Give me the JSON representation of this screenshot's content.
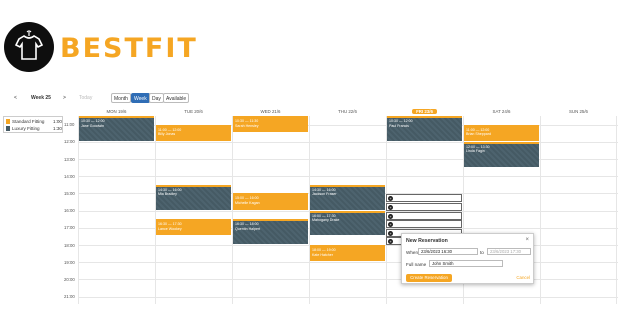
{
  "brand": {
    "name": "BESTFIT",
    "logo_icon": "shirt-icon"
  },
  "toolbar": {
    "prev": "<",
    "week": "Week 25",
    "next": ">",
    "today": "Today",
    "views": [
      "Month",
      "Week",
      "Day",
      "Available"
    ],
    "active_view": "Week"
  },
  "legend": [
    {
      "name": "Standard Fitting",
      "value": "1:00",
      "color": "#f5a623"
    },
    {
      "name": "Luxury Fitting",
      "value": "1:30",
      "color": "#455a64"
    }
  ],
  "days": [
    "MON 19/6",
    "TUE 20/6",
    "WED 21/6",
    "THU 22/6",
    "FRI 23/6",
    "SAT 24/6",
    "SUN 25/6"
  ],
  "today_index": 4,
  "hours": [
    "11:00",
    "12:00",
    "13:00",
    "14:00",
    "15:00",
    "16:00",
    "17:00",
    "18:00",
    "19:00",
    "20:00",
    "21:00"
  ],
  "events": [
    {
      "day": 0,
      "start": 10.5,
      "end": 12.0,
      "type": "lux",
      "time": "10:30 — 12:00",
      "name": "Jane Goodwin"
    },
    {
      "day": 1,
      "start": 11.0,
      "end": 12.0,
      "type": "std",
      "time": "11:00 — 12:00",
      "name": "Billy Jonas"
    },
    {
      "day": 2,
      "start": 10.5,
      "end": 11.5,
      "type": "std",
      "time": "10:30 — 11:30",
      "name": "Sarah Hensley"
    },
    {
      "day": 4,
      "start": 10.5,
      "end": 12.0,
      "type": "lux",
      "time": "10:30 — 12:00",
      "name": "Paul Francis"
    },
    {
      "day": 5,
      "start": 11.0,
      "end": 12.0,
      "type": "std",
      "time": "11:00 — 12:00",
      "name": "Brian Sheppard"
    },
    {
      "day": 5,
      "start": 12.0,
      "end": 13.5,
      "type": "lux",
      "time": "12:00 — 13:30",
      "name": "Linda Fagin"
    },
    {
      "day": 1,
      "start": 14.5,
      "end": 16.0,
      "type": "lux",
      "time": "14:30 — 16:00",
      "name": "Mia Bradley"
    },
    {
      "day": 1,
      "start": 16.5,
      "end": 17.5,
      "type": "std",
      "time": "16:30 — 17:30",
      "name": "Lance Wookey"
    },
    {
      "day": 2,
      "start": 15.0,
      "end": 16.0,
      "type": "std",
      "time": "15:00 — 16:00",
      "name": "Michelle Kagan"
    },
    {
      "day": 2,
      "start": 16.5,
      "end": 18.0,
      "type": "lux",
      "time": "16:30 — 18:00",
      "name": "Quentin Halpert"
    },
    {
      "day": 3,
      "start": 14.5,
      "end": 16.0,
      "type": "lux",
      "time": "14:30 — 16:00",
      "name": "Jackson Fraser"
    },
    {
      "day": 3,
      "start": 16.0,
      "end": 17.5,
      "type": "lux",
      "time": "16:00 — 17:30",
      "name": "Mahogany Drake"
    },
    {
      "day": 3,
      "start": 18.0,
      "end": 19.0,
      "type": "std",
      "time": "18:00 — 19:00",
      "name": "Kate Hatcher"
    }
  ],
  "slots": [
    15.0,
    15.5,
    16.0,
    16.5,
    17.0,
    17.5
  ],
  "popup": {
    "title": "New Reservation",
    "close": "×",
    "when_label": "When",
    "start": "23/6/2023 16:30",
    "to": "to",
    "end": "23/6/2023 17:30",
    "name_label": "Full name",
    "name_value": "John Smith",
    "create": "Create Reservation",
    "cancel": "Cancel"
  }
}
